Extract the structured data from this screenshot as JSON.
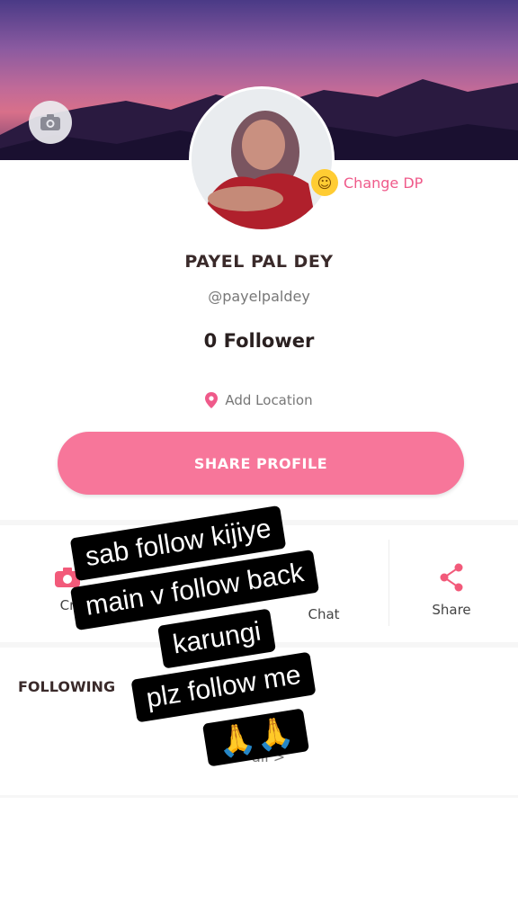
{
  "profile": {
    "name": "PAYEL PAL DEY",
    "handle": "@payelpaldey",
    "followers": "0 Follower",
    "change_dp_label": "Change DP",
    "location_label": "Add Location",
    "share_button_label": "SHARE PROFILE"
  },
  "actions": {
    "create_label": "Cr",
    "chat_label": "Chat",
    "share_label": "Share"
  },
  "following": {
    "title": "FOLLOWING",
    "see_all_label": "all >"
  },
  "overlay_caption": {
    "line1": "sab follow kijiye",
    "line2": "main v follow back",
    "line3": "karungi",
    "line4": "plz follow me",
    "emoji": "🙏🙏"
  },
  "colors": {
    "accent": "#f7769a",
    "accent_text": "#ef5a8a",
    "cover_top": "#4a3a86",
    "cover_bottom": "#6a3a6a"
  },
  "icons": {
    "cover_camera": "camera-icon",
    "location": "location-pin-icon",
    "create": "camera-icon",
    "share": "share-icon"
  }
}
